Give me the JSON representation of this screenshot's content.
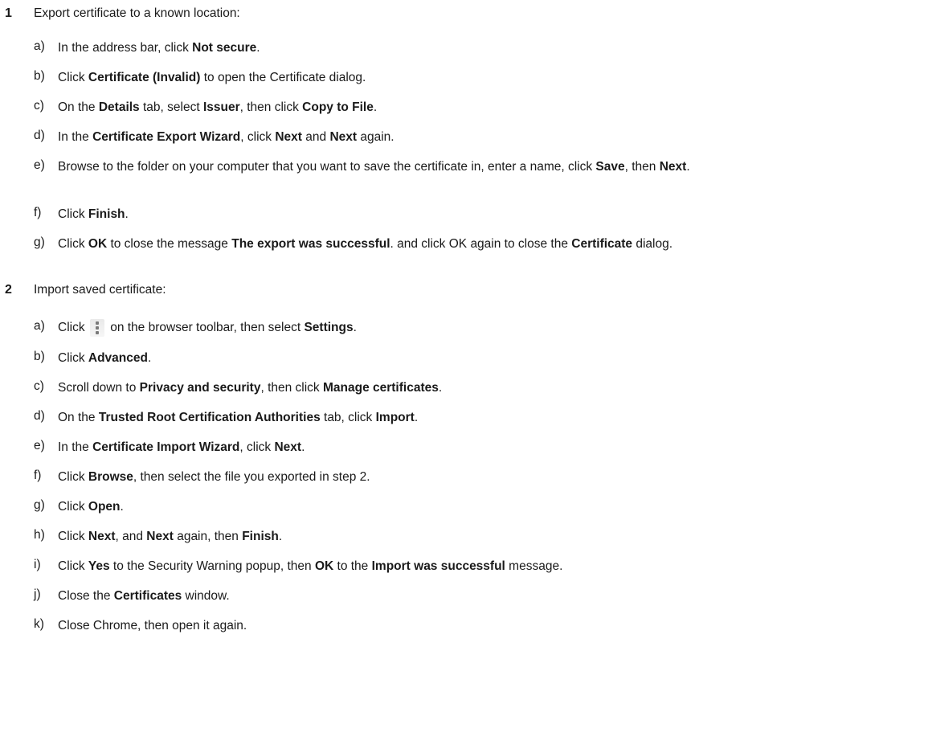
{
  "step1": {
    "num": "1",
    "title": "Export certificate to a known location:",
    "a": {
      "letter": "a)",
      "t1": "In the address bar, click ",
      "b1": "Not secure",
      "t2": "."
    },
    "b": {
      "letter": "b)",
      "t1": "Click ",
      "b1": "Certificate (Invalid)",
      "t2": " to open the Certificate dialog."
    },
    "c": {
      "letter": "c)",
      "t1": "On the ",
      "b1": "Details",
      "t2": " tab, select ",
      "b2": "Issuer",
      "t3": ", then click ",
      "b3": "Copy to File",
      "t4": "."
    },
    "d": {
      "letter": "d)",
      "t1": "In the ",
      "b1": "Certificate Export Wizard",
      "t2": ", click ",
      "b2": "Next",
      "t3": " and ",
      "b3": "Next",
      "t4": " again."
    },
    "e": {
      "letter": "e)",
      "t1": "Browse to the folder on your computer that you want to save the certificate in, enter a name, click ",
      "b1": "Save",
      "t2": ", then ",
      "b2": "Next",
      "t3": "."
    },
    "f": {
      "letter": "f)",
      "t1": "Click ",
      "b1": "Finish",
      "t2": "."
    },
    "g": {
      "letter": "g)",
      "t1": "Click ",
      "b1": "OK",
      "t2": " to close the message ",
      "b2": "The export was successful",
      "t3": ". and click OK again to close the ",
      "b3": "Certificate",
      "t4": " dialog."
    }
  },
  "step2": {
    "num": "2",
    "title": "Import saved certificate:",
    "a": {
      "letter": "a)",
      "t1": "Click ",
      "t2": " on the browser toolbar, then select ",
      "b1": "Settings",
      "t3": ".",
      "icon": "more-vertical-icon"
    },
    "b": {
      "letter": "b)",
      "t1": "Click ",
      "b1": "Advanced",
      "t2": "."
    },
    "c": {
      "letter": "c)",
      "t1": "Scroll down to ",
      "b1": "Privacy and security",
      "t2": ", then click ",
      "b2": "Manage certificates",
      "t3": "."
    },
    "d": {
      "letter": "d)",
      "t1": "On the ",
      "b1": "Trusted Root Certification Authorities",
      "t2": " tab, click ",
      "b2": "Import",
      "t3": "."
    },
    "e": {
      "letter": "e)",
      "t1": "In the ",
      "b1": "Certificate Import Wizard",
      "t2": ", click ",
      "b2": "Next",
      "t3": "."
    },
    "f": {
      "letter": "f)",
      "t1": "Click ",
      "b1": "Browse",
      "t2": ", then select the file you exported in step 2."
    },
    "g": {
      "letter": "g)",
      "t1": "Click ",
      "b1": "Open",
      "t2": "."
    },
    "h": {
      "letter": "h)",
      "t1": "Click ",
      "b1": "Next",
      "t2": ", and ",
      "b2": "Next",
      "t3": " again, then ",
      "b3": "Finish",
      "t4": "."
    },
    "i": {
      "letter": "i)",
      "t1": "Click ",
      "b1": "Yes",
      "t2": " to the Security Warning popup, then ",
      "b2": "OK",
      "t3": " to the ",
      "b3": "Import was successful",
      "t4": " message."
    },
    "j": {
      "letter": "j)",
      "t1": "Close the ",
      "b1": "Certificates",
      "t2": " window."
    },
    "k": {
      "letter": "k)",
      "t1": "Close Chrome, then open it again."
    }
  }
}
